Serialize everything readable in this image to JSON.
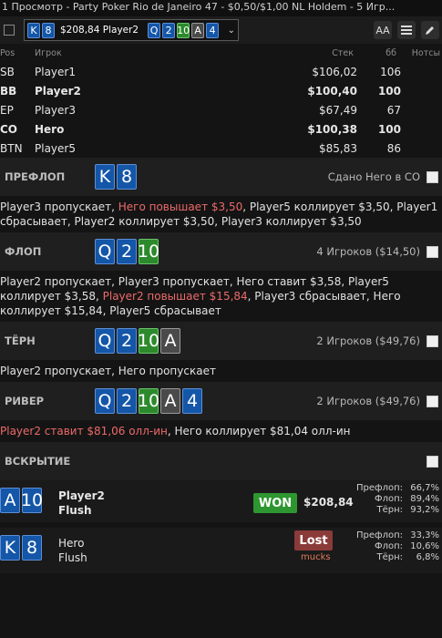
{
  "title": "1 Просмотр - Party Poker Rio de Janeiro 47 - $0,50/$1,00 NL Holdem - 5 Игр...",
  "toolbar": {
    "hand_cards": [
      "K",
      "8"
    ],
    "hand_amount": "$208,84 Player2",
    "board_cards": [
      "Q",
      "2",
      "10",
      "A",
      "4"
    ],
    "font_button": "AA"
  },
  "players_header": {
    "pos": "Pos",
    "name": "Игрок",
    "stack": "Стек",
    "bb": "бб",
    "notes": "Нотсы"
  },
  "players": [
    {
      "pos": "SB",
      "name": "Player1",
      "stack": "$106,02",
      "bb": "106",
      "bold": false
    },
    {
      "pos": "BB",
      "name": "Player2",
      "stack": "$100,40",
      "bb": "100",
      "bold": true
    },
    {
      "pos": "EP",
      "name": "Player3",
      "stack": "$67,49",
      "bb": "67",
      "bold": false
    },
    {
      "pos": "CO",
      "name": "Hero",
      "stack": "$100,38",
      "bb": "100",
      "bold": true
    },
    {
      "pos": "BTN",
      "name": "Player5",
      "stack": "$85,83",
      "bb": "86",
      "bold": false
    }
  ],
  "streets": {
    "preflop": {
      "label": "ПРЕФЛОП",
      "cards": [
        "K",
        "8"
      ],
      "info": "Сдано Него в CO",
      "actions": [
        {
          "text": "Player3 пропускает, ",
          "red": false
        },
        {
          "text": "Него повышает $3,50",
          "red": true
        },
        {
          "text": ", Player5 коллирует $3,50, Player1 сбрасывает, Player2 коллирует $3,50, Player3 коллирует $3,50",
          "red": false
        }
      ]
    },
    "flop": {
      "label": "ФЛОП",
      "cards": [
        "Q",
        "2",
        "10"
      ],
      "info": "4 Игроков ($14,50)",
      "actions": [
        {
          "text": "Player2 пропускает, Player3 пропускает, Него ставит $3,58, Player5 коллирует $3,58, ",
          "red": false
        },
        {
          "text": "Player2 повышает $15,84",
          "red": true
        },
        {
          "text": ", Player3 сбрасывает, Него коллирует $15,84, Player5 сбрасывает",
          "red": false
        }
      ]
    },
    "turn": {
      "label": "ТЁРН",
      "cards": [
        "Q",
        "2",
        "10",
        "A"
      ],
      "info": "2 Игроков ($49,76)",
      "actions": [
        {
          "text": "Player2 пропускает, Него пропускает",
          "red": false
        }
      ]
    },
    "river": {
      "label": "РИВЕР",
      "cards": [
        "Q",
        "2",
        "10",
        "A",
        "4"
      ],
      "info": "2 Игроков ($49,76)",
      "actions": [
        {
          "text": "Player2 ставит $81,06 олл-ин",
          "red": true
        },
        {
          "text": ", Него коллирует $81,04 олл-ин",
          "red": false
        }
      ]
    }
  },
  "showdown": {
    "label": "ВСКРЫТИЕ",
    "rows": [
      {
        "cards": [
          "A",
          "10"
        ],
        "name": "Player2",
        "hand": "Flush",
        "result": "WON",
        "amount": "$208,84",
        "mucks": "",
        "equity": [
          {
            "k": "Префлоп:",
            "v": "66,7%"
          },
          {
            "k": "Флоп:",
            "v": "89,4%"
          },
          {
            "k": "Тёрн:",
            "v": "93,2%"
          }
        ]
      },
      {
        "cards": [
          "K",
          "8"
        ],
        "name": "Hero",
        "hand": "Flush",
        "result": "Lost",
        "amount": "",
        "mucks": "mucks",
        "equity": [
          {
            "k": "Префлоп:",
            "v": "33,3%"
          },
          {
            "k": "Флоп:",
            "v": "10,6%"
          },
          {
            "k": "Тёрн:",
            "v": "6,8%"
          }
        ]
      }
    ]
  },
  "colors": {
    "spade_card": "#1456a8",
    "club_card": "#2c8a2c",
    "diamond_card": "#4a4a4a",
    "raise_text": "#ec6a6a",
    "won_badge": "#2e9630",
    "lost_badge": "#8b3a3a"
  }
}
